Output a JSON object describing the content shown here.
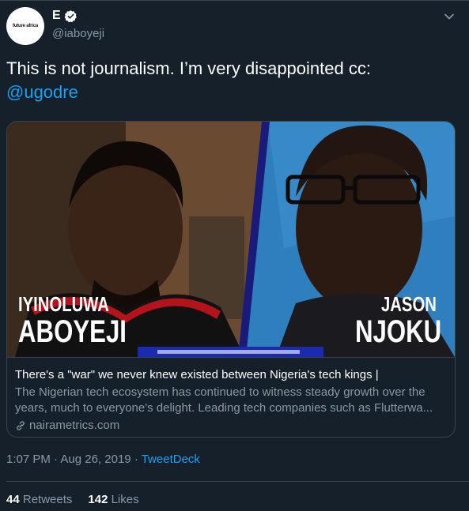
{
  "profile": {
    "avatar_text": "future africa",
    "display_name": "E",
    "handle": "@iaboyeji"
  },
  "tweet": {
    "text": "This is not journalism. I’m very disappointed cc:",
    "mention": "@ugodre"
  },
  "card": {
    "image_left_first": "IYINOLUWA",
    "image_left_last": "ABOYEJI",
    "image_right_first": "JASON",
    "image_right_last": "NJOKU",
    "title": "There's a \"war\" we never knew existed between Nigeria's tech kings |",
    "description": "The Nigerian tech ecosystem has continued to witness steady growth over the years, much to everyone's delight. Leading tech companies such as Flutterwa...",
    "domain": "nairametrics.com"
  },
  "meta": {
    "time": "1:07 PM",
    "separator1": "·",
    "date": "Aug 26, 2019",
    "separator2": "·",
    "source": "TweetDeck"
  },
  "stats": {
    "retweets_count": "44",
    "retweets_label": "Retweets",
    "likes_count": "142",
    "likes_label": "Likes"
  },
  "colors": {
    "background": "#15202b",
    "link": "#1da1f2",
    "secondary_text": "#8899a6",
    "border": "#38444d"
  },
  "icons": {
    "verified": "verified-badge-icon",
    "caret": "chevron-down-icon",
    "link": "link-icon"
  }
}
